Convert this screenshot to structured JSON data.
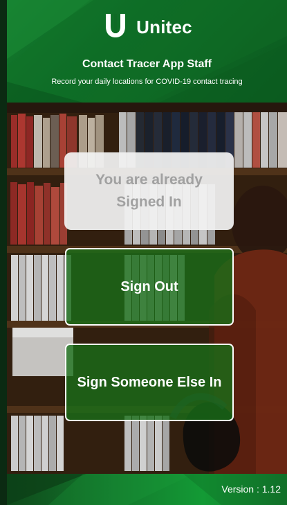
{
  "app": {
    "brand": "Unitec",
    "title": "Contact Tracer App Staff",
    "subtitle": "Record your daily locations for COVID-19 contact tracing"
  },
  "status": {
    "message": "You are already Signed In"
  },
  "actions": {
    "sign_out": "Sign Out",
    "sign_someone_else_in": "Sign Someone Else In"
  },
  "footer": {
    "version": "Version : 1.12"
  },
  "colors": {
    "header_green": "#137a2d",
    "button_green": "#187018",
    "card_bg": "#f2f2f2",
    "card_text": "#a1a1a1"
  },
  "icons": {
    "brand_logo": "unitec-u-logo-icon"
  }
}
